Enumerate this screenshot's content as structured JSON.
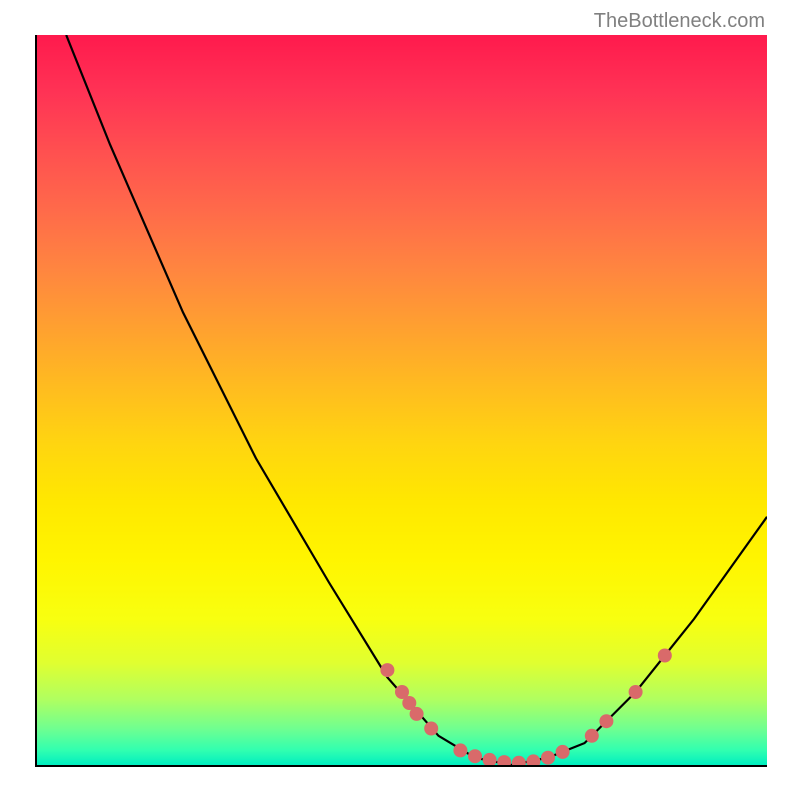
{
  "watermark": "TheBottleneck.com",
  "chart_data": {
    "type": "line",
    "title": "",
    "xlabel": "",
    "ylabel": "",
    "xlim": [
      0,
      100
    ],
    "ylim": [
      0,
      100
    ],
    "curve": {
      "name": "bottleneck-curve",
      "color": "#000000",
      "points": [
        {
          "x": 4,
          "y": 100
        },
        {
          "x": 10,
          "y": 85
        },
        {
          "x": 20,
          "y": 62
        },
        {
          "x": 30,
          "y": 42
        },
        {
          "x": 40,
          "y": 25
        },
        {
          "x": 48,
          "y": 12
        },
        {
          "x": 55,
          "y": 4
        },
        {
          "x": 60,
          "y": 1
        },
        {
          "x": 65,
          "y": 0
        },
        {
          "x": 70,
          "y": 1
        },
        {
          "x": 75,
          "y": 3
        },
        {
          "x": 82,
          "y": 10
        },
        {
          "x": 90,
          "y": 20
        },
        {
          "x": 100,
          "y": 34
        }
      ]
    },
    "markers": {
      "name": "highlight-points",
      "color": "#d96a6a",
      "radius": 7,
      "points": [
        {
          "x": 48,
          "y": 13
        },
        {
          "x": 50,
          "y": 10
        },
        {
          "x": 51,
          "y": 8.5
        },
        {
          "x": 52,
          "y": 7
        },
        {
          "x": 54,
          "y": 5
        },
        {
          "x": 58,
          "y": 2
        },
        {
          "x": 60,
          "y": 1.2
        },
        {
          "x": 62,
          "y": 0.7
        },
        {
          "x": 64,
          "y": 0.4
        },
        {
          "x": 66,
          "y": 0.3
        },
        {
          "x": 68,
          "y": 0.5
        },
        {
          "x": 70,
          "y": 1
        },
        {
          "x": 72,
          "y": 1.8
        },
        {
          "x": 76,
          "y": 4
        },
        {
          "x": 78,
          "y": 6
        },
        {
          "x": 82,
          "y": 10
        },
        {
          "x": 86,
          "y": 15
        }
      ]
    }
  }
}
